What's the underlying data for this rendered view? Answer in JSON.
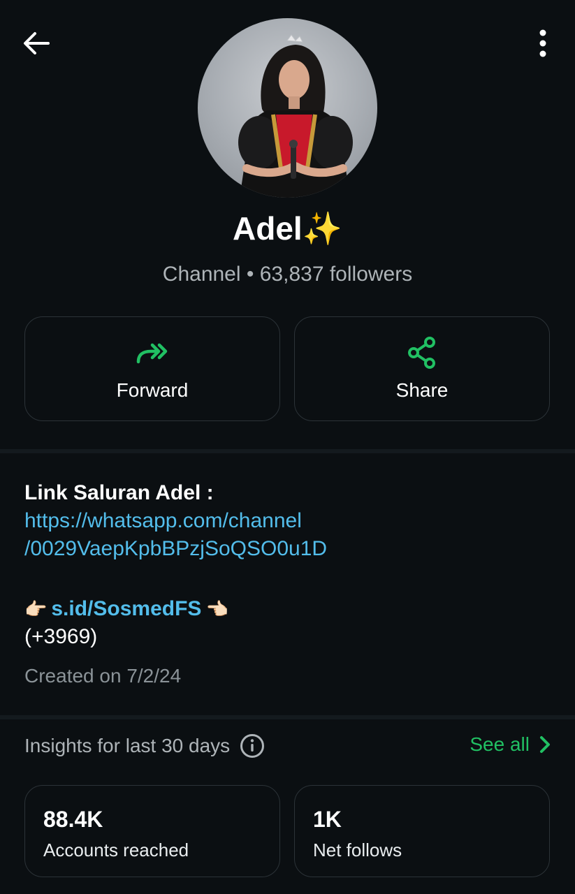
{
  "channel": {
    "name": "Adel✨",
    "type_label": "Channel",
    "separator": "•",
    "followers_text": "63,837 followers"
  },
  "actions": {
    "forward_label": "Forward",
    "share_label": "Share"
  },
  "description": {
    "title": "Link Saluran Adel :",
    "link_line1": "https://whatsapp.com/channel",
    "link_line2": "/0029VaepKpbBPzjSoQSO0u1D",
    "pointer_left": "👉🏻",
    "short_link": "s.id/SosmedFS",
    "pointer_right": "👈🏻",
    "phone_suffix": "(+3969)",
    "created_text": "Created on 7/2/24"
  },
  "insights": {
    "title": "Insights for last 30 days",
    "see_all_label": "See all",
    "stats": [
      {
        "value": "88.4K",
        "caption": "Accounts reached"
      },
      {
        "value": "1K",
        "caption": "Net follows"
      }
    ]
  },
  "colors": {
    "background": "#0b0f12",
    "accent_green": "#21c063",
    "link_blue": "#53bdeb",
    "muted_text": "#aeb4b8"
  },
  "icons": {
    "back": "arrow-left-icon",
    "menu": "more-vertical-icon",
    "forward": "forward-double-arrow-icon",
    "share": "share-nodes-icon",
    "info": "info-circle-icon",
    "chevron": "chevron-right-icon"
  }
}
